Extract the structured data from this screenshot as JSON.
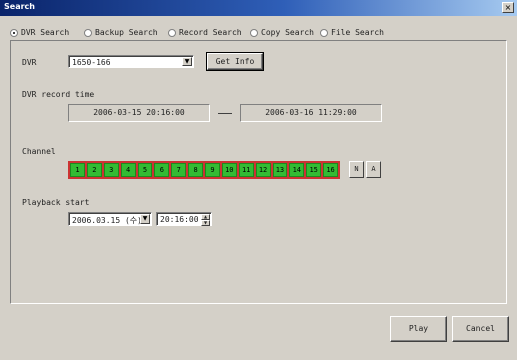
{
  "window": {
    "title": "Search",
    "close_glyph": "×"
  },
  "modes": [
    {
      "label": "DVR Search",
      "checked": true
    },
    {
      "label": "Backup Search",
      "checked": false
    },
    {
      "label": "Record Search",
      "checked": false
    },
    {
      "label": "Copy Search",
      "checked": false
    },
    {
      "label": "File Search",
      "checked": false
    }
  ],
  "dvr": {
    "label": "DVR",
    "selected": "1650-166",
    "get_info_label": "Get Info"
  },
  "record_time": {
    "label": "DVR record time",
    "start": "2006-03-15 20:16:00",
    "end": "2006-03-16 11:29:00"
  },
  "channel": {
    "label": "Channel",
    "channels": [
      "1",
      "2",
      "3",
      "4",
      "5",
      "6",
      "7",
      "8",
      "9",
      "10",
      "11",
      "12",
      "13",
      "14",
      "15",
      "16"
    ],
    "none_label": "N",
    "all_label": "A"
  },
  "playback": {
    "label": "Playback start",
    "date": "2006.03.15 (수)",
    "time": "20:16:00"
  },
  "footer": {
    "play_label": "Play",
    "cancel_label": "Cancel"
  },
  "colors": {
    "channel_on": "#33bb33",
    "channel_strip": "#cc3333",
    "title_bar": "#0a246a"
  }
}
